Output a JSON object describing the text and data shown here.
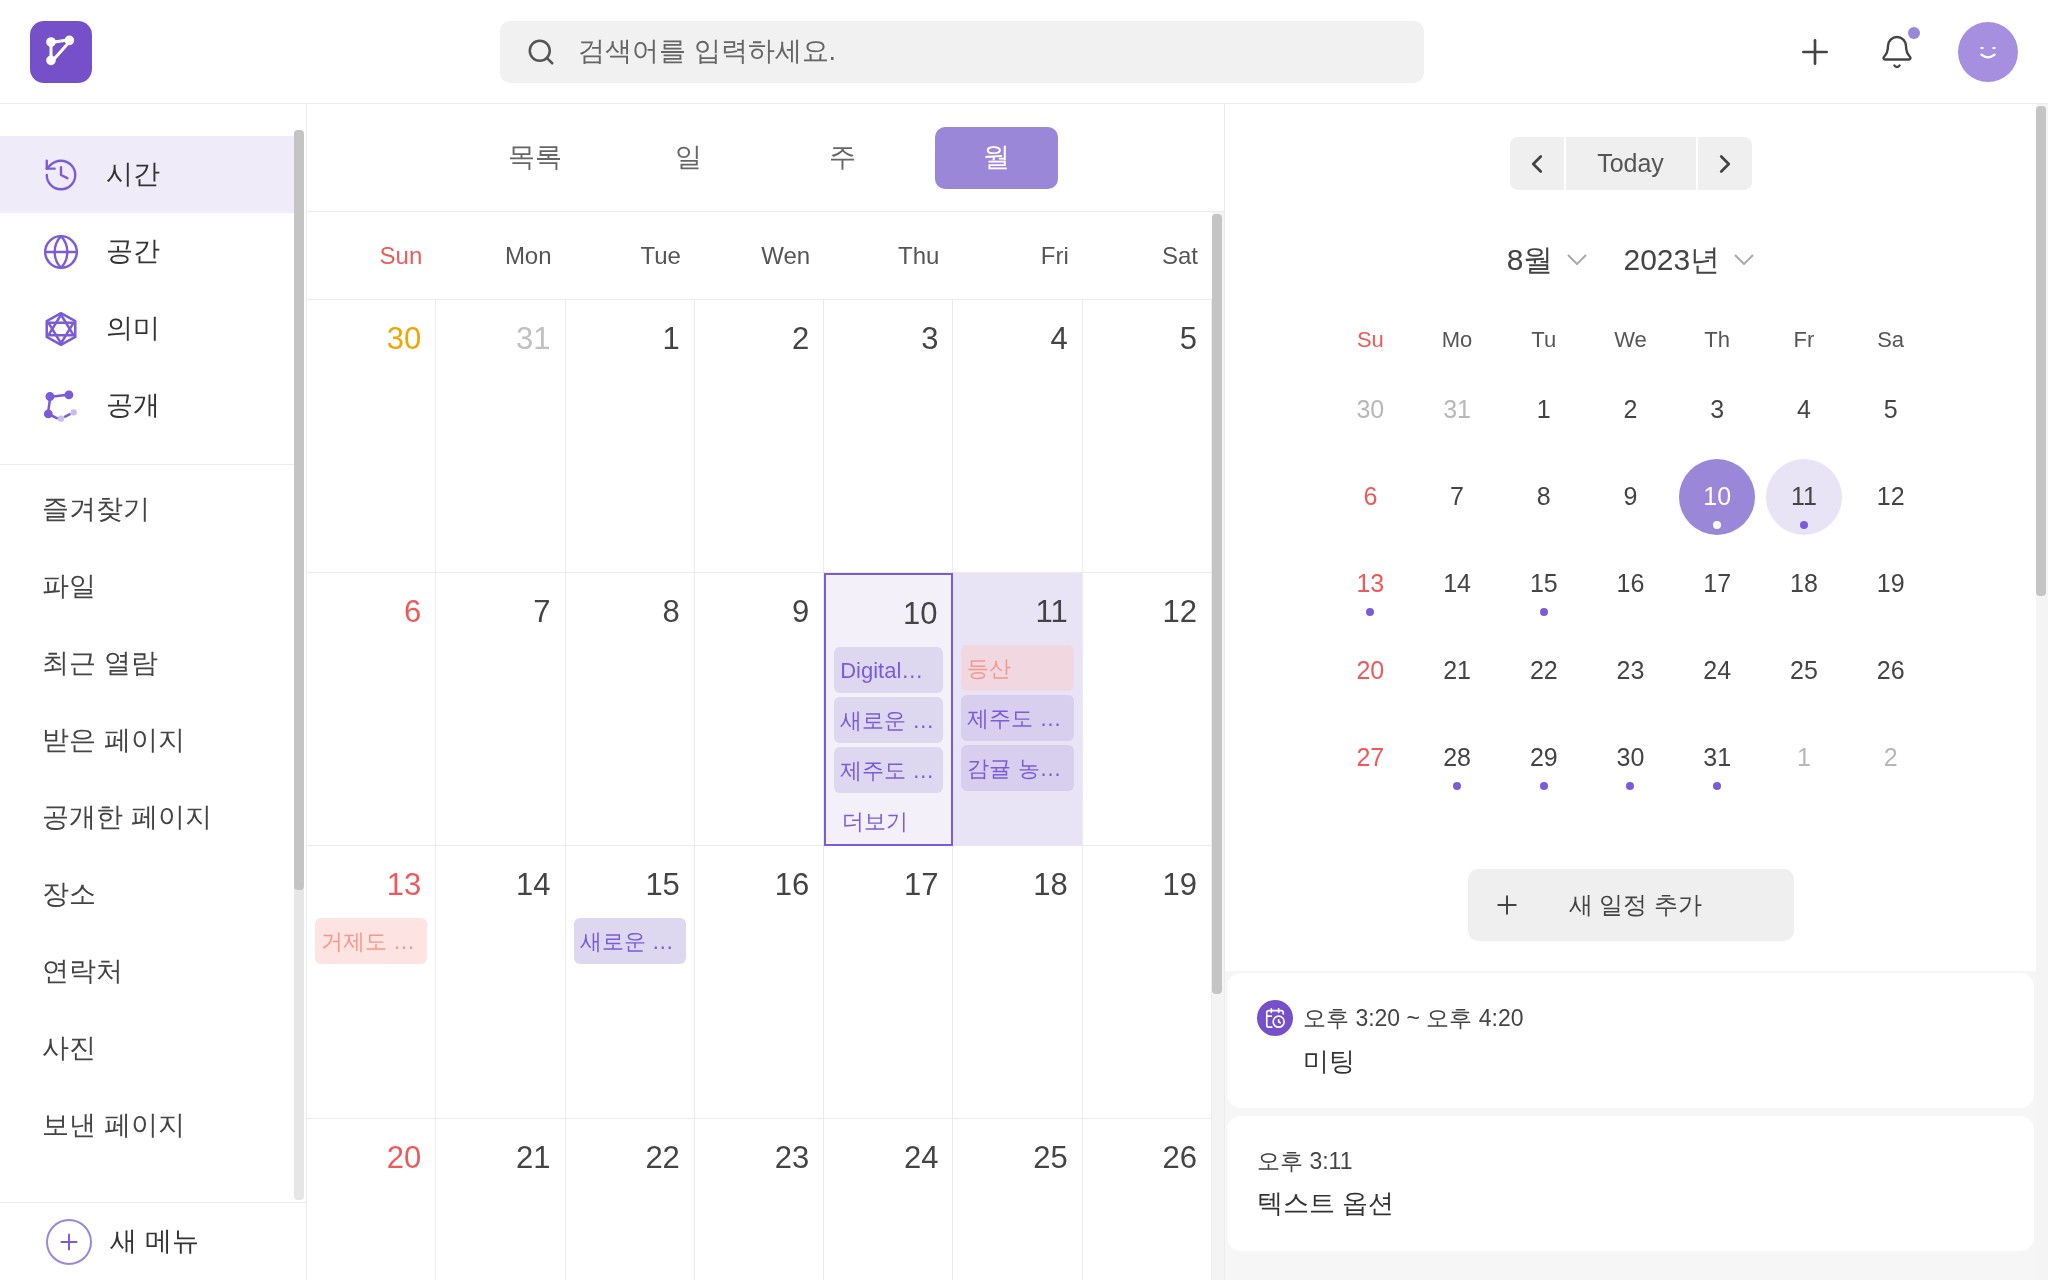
{
  "search": {
    "placeholder": "검색어를 입력하세요."
  },
  "notifications": {
    "unread": true
  },
  "sidebar": {
    "nav": [
      {
        "label": "시간",
        "selected": true
      },
      {
        "label": "공간",
        "selected": false
      },
      {
        "label": "의미",
        "selected": false
      },
      {
        "label": "공개",
        "selected": false
      }
    ],
    "items": [
      "즐겨찾기",
      "파일",
      "최근 열람",
      "받은 페이지",
      "공개한 페이지",
      "장소",
      "연락처",
      "사진",
      "보낸 페이지"
    ],
    "new_menu": "새 메뉴"
  },
  "view_tabs": [
    {
      "label": "목록",
      "selected": false
    },
    {
      "label": "일",
      "selected": false
    },
    {
      "label": "주",
      "selected": false
    },
    {
      "label": "월",
      "selected": true
    }
  ],
  "weekdays": [
    {
      "label": "Sun",
      "kind": "sunday"
    },
    {
      "label": "Mon",
      "kind": "weekday"
    },
    {
      "label": "Tue",
      "kind": "weekday"
    },
    {
      "label": "Wen",
      "kind": "weekday"
    },
    {
      "label": "Thu",
      "kind": "weekday"
    },
    {
      "label": "Fri",
      "kind": "weekday"
    },
    {
      "label": "Sat",
      "kind": "weekday"
    }
  ],
  "weeks": [
    [
      {
        "day": "30",
        "kind": "accent",
        "selected": false,
        "today": false
      },
      {
        "day": "31",
        "kind": "muted",
        "selected": false,
        "today": false
      },
      {
        "day": "1",
        "kind": "normal",
        "selected": false,
        "today": false
      },
      {
        "day": "2",
        "kind": "normal",
        "selected": false,
        "today": false
      },
      {
        "day": "3",
        "kind": "normal",
        "selected": false,
        "today": false
      },
      {
        "day": "4",
        "kind": "normal",
        "selected": false,
        "today": false
      },
      {
        "day": "5",
        "kind": "normal",
        "selected": false,
        "today": false
      }
    ],
    [
      {
        "day": "6",
        "kind": "sunday",
        "selected": false,
        "today": false
      },
      {
        "day": "7",
        "kind": "normal",
        "selected": false,
        "today": false
      },
      {
        "day": "8",
        "kind": "normal",
        "selected": false,
        "today": false
      },
      {
        "day": "9",
        "kind": "normal",
        "selected": false,
        "today": false
      },
      {
        "day": "10",
        "kind": "normal",
        "selected": true,
        "today": false,
        "events": [
          {
            "title": "Digital…",
            "kind": "purple"
          },
          {
            "title": "새로운 …",
            "kind": "purple"
          },
          {
            "title": "제주도 …",
            "kind": "purple"
          }
        ],
        "more": "더보기"
      },
      {
        "day": "11",
        "kind": "normal",
        "selected": false,
        "today": true,
        "events": [
          {
            "title": "등산",
            "kind": "pink"
          },
          {
            "title": "제주도 …",
            "kind": "purple"
          },
          {
            "title": "감귤 농…",
            "kind": "purple"
          }
        ]
      },
      {
        "day": "12",
        "kind": "normal",
        "selected": false,
        "today": false
      }
    ],
    [
      {
        "day": "13",
        "kind": "sunday",
        "selected": false,
        "today": false,
        "events": [
          {
            "title": "거제도 …",
            "kind": "pink"
          }
        ]
      },
      {
        "day": "14",
        "kind": "normal",
        "selected": false,
        "today": false
      },
      {
        "day": "15",
        "kind": "normal",
        "selected": false,
        "today": false,
        "events": [
          {
            "title": "새로운 …",
            "kind": "purple"
          }
        ]
      },
      {
        "day": "16",
        "kind": "normal",
        "selected": false,
        "today": false
      },
      {
        "day": "17",
        "kind": "normal",
        "selected": false,
        "today": false
      },
      {
        "day": "18",
        "kind": "normal",
        "selected": false,
        "today": false
      },
      {
        "day": "19",
        "kind": "normal",
        "selected": false,
        "today": false
      }
    ],
    [
      {
        "day": "20",
        "kind": "sunday",
        "selected": false,
        "today": false
      },
      {
        "day": "21",
        "kind": "normal",
        "selected": false,
        "today": false
      },
      {
        "day": "22",
        "kind": "normal",
        "selected": false,
        "today": false
      },
      {
        "day": "23",
        "kind": "normal",
        "selected": false,
        "today": false
      },
      {
        "day": "24",
        "kind": "normal",
        "selected": false,
        "today": false
      },
      {
        "day": "25",
        "kind": "normal",
        "selected": false,
        "today": false
      },
      {
        "day": "26",
        "kind": "normal",
        "selected": false,
        "today": false
      }
    ]
  ],
  "mini_calendar": {
    "today_button": "Today",
    "month": "8월",
    "year": "2023년",
    "weekdays": [
      {
        "label": "Su",
        "kind": "sunday"
      },
      {
        "label": "Mo",
        "kind": "weekday"
      },
      {
        "label": "Tu",
        "kind": "weekday"
      },
      {
        "label": "We",
        "kind": "weekday"
      },
      {
        "label": "Th",
        "kind": "weekday"
      },
      {
        "label": "Fr",
        "kind": "weekday"
      },
      {
        "label": "Sa",
        "kind": "weekday"
      }
    ],
    "days": [
      {
        "day": "30",
        "kind": "muted",
        "selected": false,
        "today": false,
        "has_events": false
      },
      {
        "day": "31",
        "kind": "muted",
        "selected": false,
        "today": false,
        "has_events": false
      },
      {
        "day": "1",
        "kind": "normal",
        "selected": false,
        "today": false,
        "has_events": false
      },
      {
        "day": "2",
        "kind": "normal",
        "selected": false,
        "today": false,
        "has_events": false
      },
      {
        "day": "3",
        "kind": "normal",
        "selected": false,
        "today": false,
        "has_events": false
      },
      {
        "day": "4",
        "kind": "normal",
        "selected": false,
        "today": false,
        "has_events": false
      },
      {
        "day": "5",
        "kind": "normal",
        "selected": false,
        "today": false,
        "has_events": false
      },
      {
        "day": "6",
        "kind": "sunday",
        "selected": false,
        "today": false,
        "has_events": false
      },
      {
        "day": "7",
        "kind": "normal",
        "selected": false,
        "today": false,
        "has_events": false
      },
      {
        "day": "8",
        "kind": "normal",
        "selected": false,
        "today": false,
        "has_events": false
      },
      {
        "day": "9",
        "kind": "normal",
        "selected": false,
        "today": false,
        "has_events": false
      },
      {
        "day": "10",
        "kind": "normal",
        "selected": true,
        "today": false,
        "has_events": true
      },
      {
        "day": "11",
        "kind": "normal",
        "selected": false,
        "today": true,
        "has_events": true
      },
      {
        "day": "12",
        "kind": "normal",
        "selected": false,
        "today": false,
        "has_events": false
      },
      {
        "day": "13",
        "kind": "sunday",
        "selected": false,
        "today": false,
        "has_events": true
      },
      {
        "day": "14",
        "kind": "normal",
        "selected": false,
        "today": false,
        "has_events": false
      },
      {
        "day": "15",
        "kind": "normal",
        "selected": false,
        "today": false,
        "has_events": true
      },
      {
        "day": "16",
        "kind": "normal",
        "selected": false,
        "today": false,
        "has_events": false
      },
      {
        "day": "17",
        "kind": "normal",
        "selected": false,
        "today": false,
        "has_events": false
      },
      {
        "day": "18",
        "kind": "normal",
        "selected": false,
        "today": false,
        "has_events": false
      },
      {
        "day": "19",
        "kind": "normal",
        "selected": false,
        "today": false,
        "has_events": false
      },
      {
        "day": "20",
        "kind": "sunday",
        "selected": false,
        "today": false,
        "has_events": false
      },
      {
        "day": "21",
        "kind": "normal",
        "selected": false,
        "today": false,
        "has_events": false
      },
      {
        "day": "22",
        "kind": "normal",
        "selected": false,
        "today": false,
        "has_events": false
      },
      {
        "day": "23",
        "kind": "normal",
        "selected": false,
        "today": false,
        "has_events": false
      },
      {
        "day": "24",
        "kind": "normal",
        "selected": false,
        "today": false,
        "has_events": false
      },
      {
        "day": "25",
        "kind": "normal",
        "selected": false,
        "today": false,
        "has_events": false
      },
      {
        "day": "26",
        "kind": "normal",
        "selected": false,
        "today": false,
        "has_events": false
      },
      {
        "day": "27",
        "kind": "sunday",
        "selected": false,
        "today": false,
        "has_events": false
      },
      {
        "day": "28",
        "kind": "normal",
        "selected": false,
        "today": false,
        "has_events": true
      },
      {
        "day": "29",
        "kind": "normal",
        "selected": false,
        "today": false,
        "has_events": true
      },
      {
        "day": "30",
        "kind": "normal",
        "selected": false,
        "today": false,
        "has_events": true
      },
      {
        "day": "31",
        "kind": "normal",
        "selected": false,
        "today": false,
        "has_events": true
      },
      {
        "day": "1",
        "kind": "muted",
        "selected": false,
        "today": false,
        "has_events": false
      },
      {
        "day": "2",
        "kind": "muted",
        "selected": false,
        "today": false,
        "has_events": false
      }
    ]
  },
  "add_event": "새 일정 추가",
  "agenda": [
    {
      "kind": "schedule",
      "time": "오후 3:20 ~ 오후 4:20",
      "title": "미팅"
    },
    {
      "kind": "note",
      "time": "오후 3:11",
      "title": "텍스트 옵션"
    }
  ]
}
